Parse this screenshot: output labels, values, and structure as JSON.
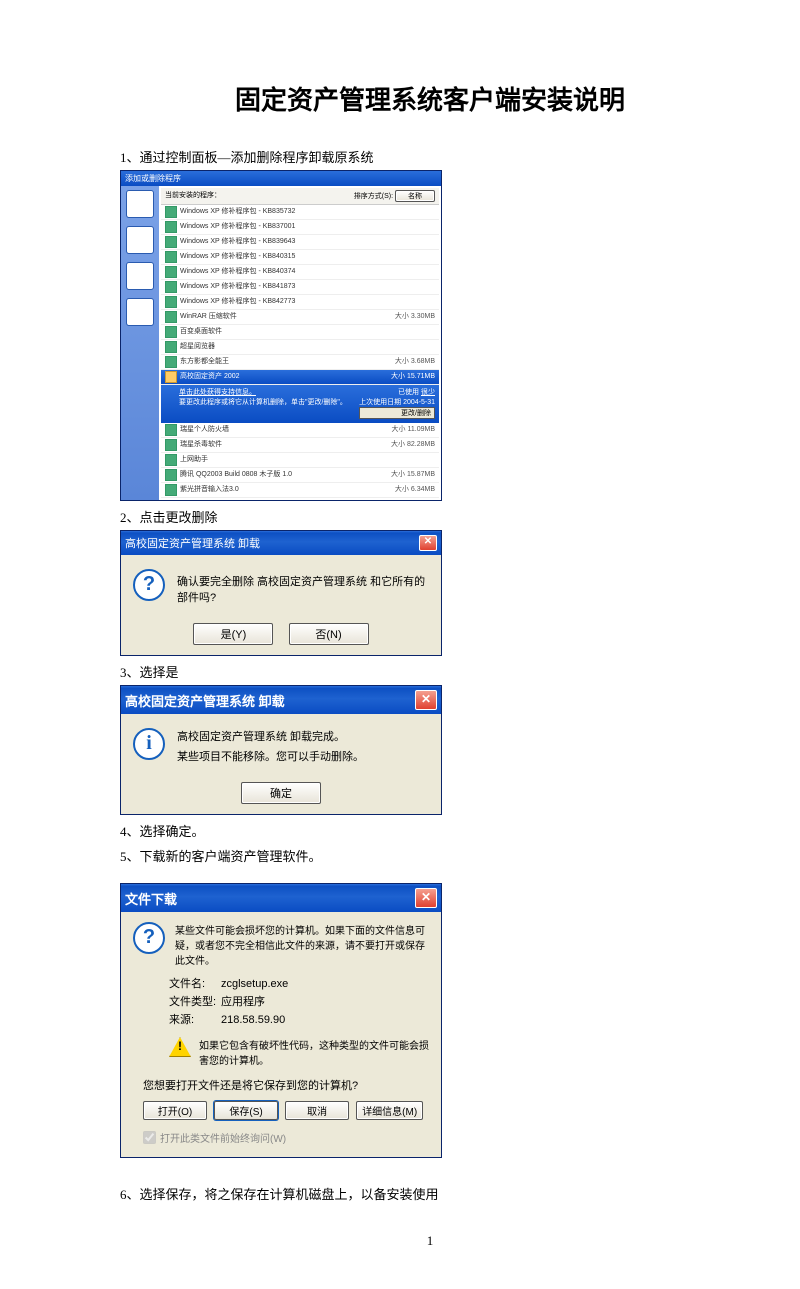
{
  "title": "固定资产管理系统客户端安装说明",
  "steps": {
    "s1": "1、通过控制面板—添加删除程序卸载原系统",
    "s2": "2、点击更改删除",
    "s3": "3、选择是",
    "s4": "4、选择确定。",
    "s5": "5、下载新的客户端资产管理软件。",
    "s6": "6、选择保存，将之保存在计算机磁盘上，以备安装使用"
  },
  "page_number": "1",
  "arp": {
    "title": "添加或删除程序",
    "head_left": "当前安装的程序：",
    "sort_label": "排序方式(S):",
    "sort_value": "名称",
    "rows": [
      {
        "name": "Windows XP 修补程序包 - KB835732",
        "size": ""
      },
      {
        "name": "Windows XP 修补程序包 - KB837001",
        "size": ""
      },
      {
        "name": "Windows XP 修补程序包 - KB839643",
        "size": ""
      },
      {
        "name": "Windows XP 修补程序包 - KB840315",
        "size": ""
      },
      {
        "name": "Windows XP 修补程序包 - KB840374",
        "size": ""
      },
      {
        "name": "Windows XP 修补程序包 - KB841873",
        "size": ""
      },
      {
        "name": "Windows XP 修补程序包 - KB842773",
        "size": ""
      },
      {
        "name": "WinRAR 压缩软件",
        "size": "3.30MB"
      },
      {
        "name": "百变桌面软件",
        "size": ""
      },
      {
        "name": "超星阅览器",
        "size": ""
      },
      {
        "name": "东方影都全能王",
        "size": "3.68MB"
      }
    ],
    "selected": {
      "name": "高校固定资产 2002",
      "size": "15.71MB",
      "support": "单击此处获得支持信息。",
      "hint": "要更改此程序或将它从计算机删除，单击\"更改/删除\"。",
      "status_used": "已使用",
      "status_freq": "很少",
      "last_label": "上次使用日期",
      "last_date": "2004-5-31",
      "btn": "更改/删除"
    },
    "rows_after": [
      {
        "name": "瑞星个人防火墙",
        "size": "11.09MB"
      },
      {
        "name": "瑞星杀毒软件",
        "size": "82.28MB"
      },
      {
        "name": "上网助手",
        "size": ""
      },
      {
        "name": "腾讯 QQ2003 Build 0808 木子版 1.0",
        "size": "15.87MB"
      },
      {
        "name": "紫光拼音输入法3.0",
        "size": "6.34MB"
      }
    ]
  },
  "confirm1": {
    "title": "高校固定资产管理系统 卸载",
    "msg": "确认要完全删除 高校固定资产管理系统 和它所有的部件吗?",
    "yes": "是(Y)",
    "no": "否(N)"
  },
  "done": {
    "title": "高校固定资产管理系统 卸载",
    "msg1": "高校固定资产管理系统 卸载完成。",
    "msg2": "某些项目不能移除。您可以手动删除。",
    "ok": "确定"
  },
  "download": {
    "title": "文件下载",
    "warn_top": "某些文件可能会损坏您的计算机。如果下面的文件信息可疑，或者您不完全相信此文件的来源，请不要打开或保存此文件。",
    "file_label": "文件名:",
    "file_name": "zcglsetup.exe",
    "type_label": "文件类型:",
    "type_value": "应用程序",
    "from_label": "来源:",
    "from_value": "218.58.59.90",
    "warn_bottom": "如果它包含有破坏性代码，这种类型的文件可能会损害您的计算机。",
    "question": "您想要打开文件还是将它保存到您的计算机?",
    "open": "打开(O)",
    "save": "保存(S)",
    "cancel": "取消",
    "more": "详细信息(M)",
    "check": "打开此类文件前始终询问(W)"
  }
}
